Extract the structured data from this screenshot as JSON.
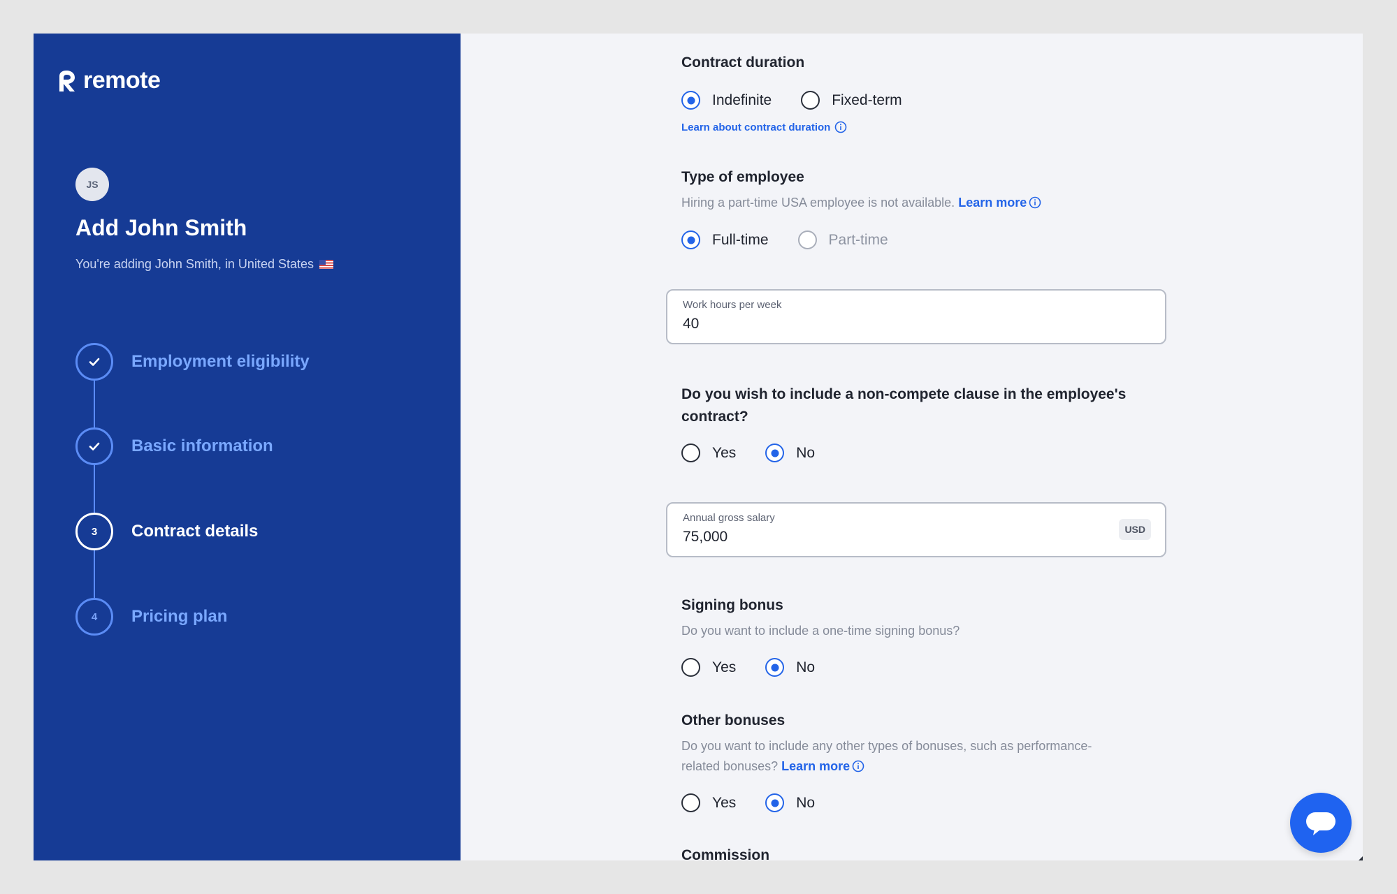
{
  "brand": {
    "name": "remote"
  },
  "sidebar": {
    "avatar_initials": "JS",
    "title": "Add John Smith",
    "subtitle": "You're adding John Smith, in United States",
    "flag_icon": "us-flag-icon",
    "steps": [
      {
        "label": "Employment eligibility",
        "status": "complete",
        "marker": ""
      },
      {
        "label": "Basic information",
        "status": "complete",
        "marker": ""
      },
      {
        "label": "Contract details",
        "status": "current",
        "marker": "3"
      },
      {
        "label": "Pricing plan",
        "status": "pending",
        "marker": "4"
      }
    ]
  },
  "form": {
    "contract_duration": {
      "title": "Contract duration",
      "options": [
        "Indefinite",
        "Fixed-term"
      ],
      "selected": "Indefinite",
      "learn_link": "Learn about contract duration"
    },
    "employee_type": {
      "title": "Type of employee",
      "helper": "Hiring a part-time USA employee is not available.",
      "learn_link": "Learn more",
      "options": [
        "Full-time",
        "Part-time"
      ],
      "selected": "Full-time",
      "disabled": [
        "Part-time"
      ]
    },
    "work_hours": {
      "label": "Work hours per week",
      "value": "40"
    },
    "non_compete": {
      "title_line1": "Do you wish to include a non-compete clause in the employee's",
      "title_line2": "contract?",
      "options": [
        "Yes",
        "No"
      ],
      "selected": "No"
    },
    "salary": {
      "label": "Annual gross salary",
      "value": "75,000",
      "currency": "USD"
    },
    "signing_bonus": {
      "title": "Signing bonus",
      "helper": "Do you want to include a one-time signing bonus?",
      "options": [
        "Yes",
        "No"
      ],
      "selected": "No"
    },
    "other_bonuses": {
      "title": "Other bonuses",
      "helper_line1": "Do you want to include any other types of bonuses, such as performance-",
      "helper_line2": "related bonuses?",
      "learn_link": "Learn more",
      "options": [
        "Yes",
        "No"
      ],
      "selected": "No"
    },
    "commission": {
      "title": "Commission"
    }
  },
  "chat": {
    "icon": "chat-bubble-icon"
  },
  "colors": {
    "sidebar_bg": "#163b95",
    "accent": "#2364e8",
    "step_complete": "#5b8cf5",
    "main_bg": "#f3f4f8"
  }
}
